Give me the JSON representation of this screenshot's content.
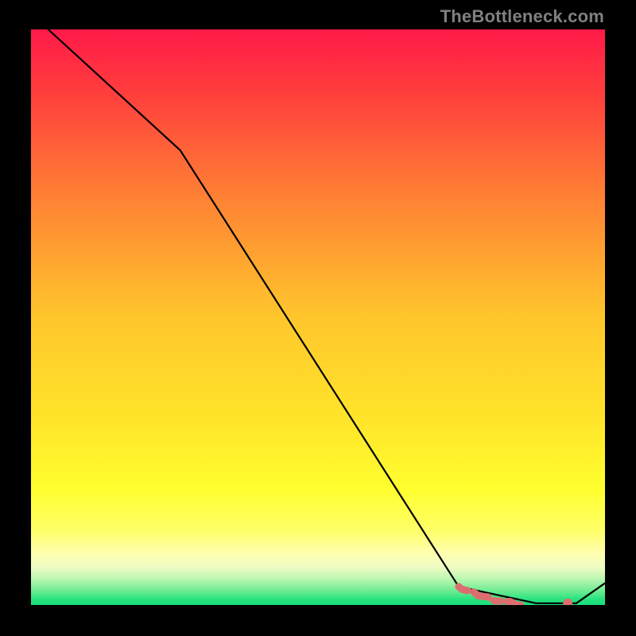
{
  "watermark": "TheBottleneck.com",
  "chart_data": {
    "type": "line",
    "title": "",
    "xlabel": "",
    "ylabel": "",
    "xlim": [
      0,
      100
    ],
    "ylim": [
      0,
      100
    ],
    "grid": false,
    "legend": false,
    "series": [
      {
        "name": "curve",
        "x": [
          3.0,
          26.0,
          74.5,
          88.0,
          95.0,
          100.0
        ],
        "values": [
          100.0,
          79.0,
          3.2,
          0.3,
          0.3,
          3.8
        ],
        "color": "#000000"
      },
      {
        "name": "highlight",
        "x": [
          74.5,
          75.1,
          77.1,
          77.9,
          79.6,
          80.7,
          83.5,
          84.6,
          86.3,
          89.0,
          89.6,
          93.0,
          93.5
        ],
        "values": [
          3.2,
          2.7,
          2.3,
          1.6,
          1.4,
          0.7,
          0.6,
          0.0,
          0.0,
          0.0,
          0.0,
          0.3,
          0.3
        ],
        "color": "#dd6e70"
      }
    ],
    "background_gradient": {
      "stops": [
        {
          "offset": 0.0,
          "color": "#ff1a49"
        },
        {
          "offset": 0.1,
          "color": "#ff3a3d"
        },
        {
          "offset": 0.3,
          "color": "#ff8434"
        },
        {
          "offset": 0.5,
          "color": "#ffc62c"
        },
        {
          "offset": 0.68,
          "color": "#ffe52a"
        },
        {
          "offset": 0.8,
          "color": "#ffff2f"
        },
        {
          "offset": 0.87,
          "color": "#ffff68"
        },
        {
          "offset": 0.91,
          "color": "#ffffb0"
        },
        {
          "offset": 0.935,
          "color": "#eefcc4"
        },
        {
          "offset": 0.955,
          "color": "#baf6b0"
        },
        {
          "offset": 0.975,
          "color": "#6fec92"
        },
        {
          "offset": 0.99,
          "color": "#28e27f"
        },
        {
          "offset": 1.0,
          "color": "#17df7a"
        }
      ]
    }
  }
}
